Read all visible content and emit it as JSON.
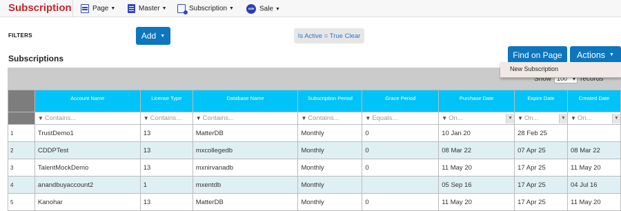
{
  "brand": "Subscription",
  "nav": [
    {
      "label": "Page",
      "icon": "page-icon"
    },
    {
      "label": "Master",
      "icon": "master-icon"
    },
    {
      "label": "Subscription",
      "icon": "subscription-icon"
    },
    {
      "label": "Sale",
      "icon": "sale-icon",
      "icon_text": "sale"
    }
  ],
  "filters": {
    "label": "FILTERS",
    "add_label": "Add",
    "active_filter": "Is Active = True Clear"
  },
  "section_title": "Subscriptions",
  "toolbar": {
    "find_label": "Find on Page",
    "actions_label": "Actions",
    "show_prefix": "Show",
    "page_size": "100",
    "show_suffix": "records"
  },
  "actions_menu": [
    "New Subscription"
  ],
  "colors": {
    "accent": "#0d76bd",
    "header": "#00c3f7",
    "brand": "#c9242b",
    "alt_row": "#dff0f4"
  },
  "table": {
    "columns": [
      "Account Name",
      "License Type",
      "Database Name",
      "Subscription Period",
      "Grace Period",
      "Purchase Date",
      "Expire Date",
      "Created Date"
    ],
    "filter_placeholders": [
      "Contains...",
      "Contains...",
      "Contains...",
      "Contains...",
      "Equals...",
      "On...",
      "On...",
      "On..."
    ],
    "rows": [
      {
        "n": "1",
        "cells": [
          "TrustDemo1",
          "13",
          "MatterDB",
          "Monthly",
          "0",
          "10 Jan 20",
          "28 Feb 25",
          ""
        ]
      },
      {
        "n": "2",
        "cells": [
          "CDDPTest",
          "13",
          "mxcollegedb",
          "Monthly",
          "0",
          "08 Mar 22",
          "07 Apr 25",
          "08 Mar 22"
        ]
      },
      {
        "n": "3",
        "cells": [
          "TalentMockDemo",
          "13",
          "mxnirvanadb",
          "Monthly",
          "0",
          "11 May 20",
          "17 Apr 25",
          "11 May 20"
        ]
      },
      {
        "n": "4",
        "cells": [
          "anandbuyaccount2",
          "1",
          "mxentdb",
          "Monthly",
          "",
          "05 Sep 16",
          "17 Apr 25",
          "04 Jul 16"
        ]
      },
      {
        "n": "5",
        "cells": [
          "Kanohar",
          "13",
          "MatterDB",
          "Monthly",
          "0",
          "11 May 20",
          "17 Apr 25",
          "11 May 20"
        ]
      }
    ]
  }
}
